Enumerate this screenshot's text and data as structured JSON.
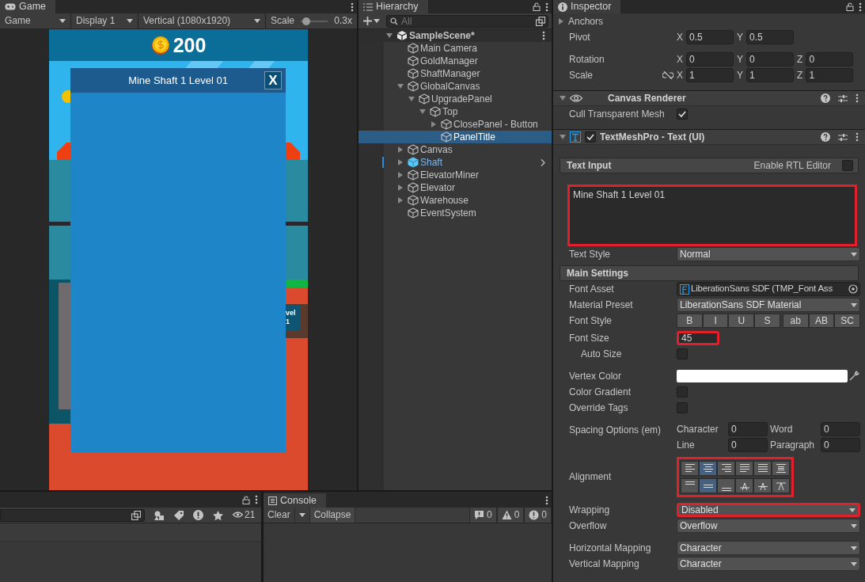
{
  "game": {
    "tab": "Game",
    "mode": "Game",
    "display": "Display 1",
    "resolution": "Vertical (1080x1920)",
    "scale": {
      "label": "Scale",
      "level": 0.05,
      "value": "0.3x"
    },
    "scene": {
      "gold": "200",
      "panel_title": "Mine Shaft 1 Level 01",
      "close_label": "X",
      "badge_lines": [
        "vel",
        "1"
      ]
    }
  },
  "hierarchy": {
    "tab": "Hierarchy",
    "search_placeholder": "All",
    "items": [
      {
        "label": "SampleScene*",
        "kind": "scene",
        "expandable": true,
        "expanded": true,
        "selected": false,
        "children": [
          {
            "label": "Main Camera",
            "kind": "object",
            "expandable": false,
            "selected": false
          },
          {
            "label": "GoldManager",
            "kind": "object",
            "expandable": false,
            "selected": false
          },
          {
            "label": "ShaftManager",
            "kind": "object",
            "expandable": false,
            "selected": false
          },
          {
            "label": "GlobalCanvas",
            "kind": "object",
            "expandable": true,
            "expanded": true,
            "selected": false,
            "children": [
              {
                "label": "UpgradePanel",
                "kind": "object",
                "expandable": true,
                "expanded": true,
                "selected": false,
                "children": [
                  {
                    "label": "Top",
                    "kind": "object",
                    "expandable": true,
                    "expanded": true,
                    "selected": false,
                    "children": [
                      {
                        "label": "ClosePanel - Button",
                        "kind": "object",
                        "expandable": true,
                        "expanded": false,
                        "selected": false
                      },
                      {
                        "label": "PanelTitle",
                        "kind": "object",
                        "expandable": false,
                        "selected": true
                      }
                    ]
                  }
                ]
              }
            ]
          },
          {
            "label": "Canvas",
            "kind": "object",
            "expandable": true,
            "expanded": false,
            "selected": false
          },
          {
            "label": "Shaft",
            "kind": "prefab",
            "expandable": true,
            "expanded": false,
            "selected": false
          },
          {
            "label": "ElevatorMiner",
            "kind": "object",
            "expandable": true,
            "expanded": false,
            "selected": false
          },
          {
            "label": "Elevator",
            "kind": "object",
            "expandable": true,
            "expanded": false,
            "selected": false
          },
          {
            "label": "Warehouse",
            "kind": "object",
            "expandable": true,
            "expanded": false,
            "selected": false
          },
          {
            "label": "EventSystem",
            "kind": "object",
            "expandable": false,
            "selected": false
          }
        ]
      }
    ]
  },
  "inspector": {
    "tab": "Inspector",
    "rows": [
      {
        "kind": "foldout",
        "label": "Anchors",
        "expanded": false
      },
      {
        "kind": "vector",
        "label": "Pivot",
        "fields": [
          {
            "axis": "X",
            "value": "0.5"
          },
          {
            "axis": "Y",
            "value": "0.5"
          }
        ]
      },
      {
        "kind": "vector",
        "label": "Rotation",
        "fields": [
          {
            "axis": "X",
            "value": "0"
          },
          {
            "axis": "Y",
            "value": "0"
          },
          {
            "axis": "Z",
            "value": "0"
          }
        ]
      },
      {
        "kind": "vector",
        "label": "Scale",
        "linked": false,
        "fields": [
          {
            "axis": "X",
            "value": "1"
          },
          {
            "axis": "Y",
            "value": "1"
          },
          {
            "axis": "Z",
            "value": "1"
          }
        ]
      },
      {
        "kind": "renderer",
        "label": "Canvas Renderer",
        "expanded": true
      },
      {
        "kind": "checkbox",
        "label": "Cull Transparent Mesh",
        "checked": true
      },
      {
        "kind": "textmesh",
        "label": "TextMeshPro - Text (UI)",
        "expanded": true,
        "enabled": true
      },
      {
        "kind": "section",
        "label": "Text Input",
        "option": "Enable RTL Editor",
        "checked": false
      },
      {
        "kind": "textarea",
        "value": "Mine Shaft 1 Level 01",
        "highlighted": true
      },
      {
        "kind": "dropdown",
        "label": "Text Style",
        "value": "Normal",
        "highlighted": false
      },
      {
        "kind": "section",
        "label": "Main Settings"
      },
      {
        "kind": "object",
        "label": "Font Asset",
        "value": "LiberationSans SDF (TMP_Font Ass"
      },
      {
        "kind": "dropdown",
        "label": "Material Preset",
        "value": "LiberationSans SDF Material",
        "highlighted": false
      },
      {
        "kind": "toggles",
        "label": "Font Style",
        "groups": [
          {
            "buttons": [
              {
                "label": "B",
                "selected": false
              },
              {
                "label": "I",
                "selected": false
              },
              {
                "label": "U",
                "selected": false
              },
              {
                "label": "S",
                "selected": false
              }
            ]
          },
          {
            "buttons": [
              {
                "label": "ab",
                "selected": false
              },
              {
                "label": "AB",
                "selected": false
              },
              {
                "label": "SC",
                "selected": false
              }
            ]
          }
        ]
      },
      {
        "kind": "number",
        "label": "Font Size",
        "value": "45",
        "highlighted": true,
        "children": [
          {
            "kind": "checkbox",
            "label": "Auto Size",
            "checked": false
          }
        ]
      },
      {
        "kind": "color",
        "label": "Vertex Color",
        "color": "#ffffff"
      },
      {
        "kind": "checkbox",
        "label": "Color Gradient",
        "checked": false
      },
      {
        "kind": "checkbox",
        "label": "Override Tags",
        "checked": false
      },
      {
        "kind": "spacing",
        "label": "Spacing Options (em)",
        "fields": [
          {
            "label": "Character",
            "value": "0"
          },
          {
            "label": "Word",
            "value": "0"
          },
          {
            "label": "Line",
            "value": "0"
          },
          {
            "label": "Paragraph",
            "value": "0"
          }
        ]
      },
      {
        "kind": "alignment",
        "label": "Alignment",
        "highlighted": true,
        "rows": [
          {
            "buttons": [
              {
                "selected": false
              },
              {
                "selected": true
              },
              {
                "selected": false
              },
              {
                "selected": false
              },
              {
                "selected": false
              },
              {
                "selected": false
              }
            ]
          },
          {
            "buttons": [
              {
                "selected": false
              },
              {
                "selected": true
              },
              {
                "selected": false
              },
              {
                "selected": false
              },
              {
                "selected": false
              },
              {
                "selected": false
              }
            ]
          }
        ]
      },
      {
        "kind": "dropdown",
        "label": "Wrapping",
        "value": "Disabled",
        "highlighted": true
      },
      {
        "kind": "dropdown",
        "label": "Overflow",
        "value": "Overflow",
        "highlighted": false
      },
      {
        "kind": "dropdown",
        "label": "Horizontal Mapping",
        "value": "Character",
        "highlighted": false
      },
      {
        "kind": "dropdown",
        "label": "Vertical Mapping",
        "value": "Character",
        "highlighted": false
      }
    ]
  },
  "project": {
    "hidden_count": "21"
  },
  "console": {
    "tab": "Console",
    "clear": "Clear",
    "collapse": "Collapse",
    "counts": [
      {
        "kind": "info",
        "value": "0"
      },
      {
        "kind": "warning",
        "value": "0"
      },
      {
        "kind": "error",
        "value": "0"
      }
    ]
  }
}
